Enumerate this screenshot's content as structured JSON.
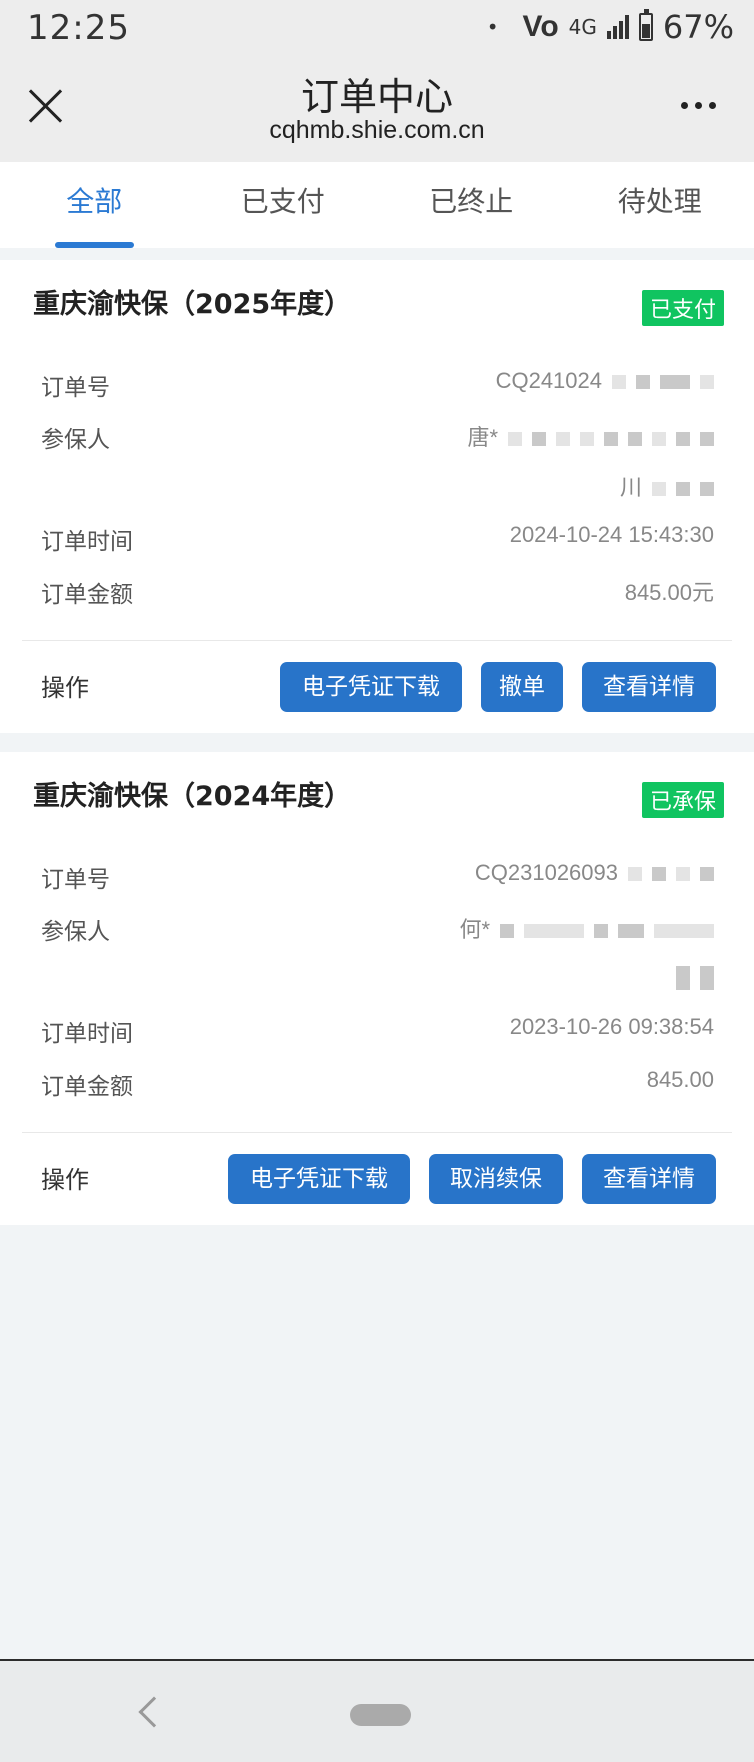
{
  "status": {
    "time": "12:25",
    "dot": "•",
    "volte": "Vo",
    "network": "4G",
    "battery": "67%"
  },
  "header": {
    "title": "订单中心",
    "url": "cqhmb.shie.com.cn"
  },
  "tabs": [
    {
      "label": "全部",
      "active": true
    },
    {
      "label": "已支付",
      "active": false
    },
    {
      "label": "已终止",
      "active": false
    },
    {
      "label": "待处理",
      "active": false
    }
  ],
  "orders": [
    {
      "title": "重庆渝快保（2025年度）",
      "status": "已支付",
      "order_no_label": "订单号",
      "order_no": "CQ241024",
      "insured_label": "参保人",
      "insured": "唐*",
      "insured_extra": "川",
      "time_label": "订单时间",
      "time": "2024-10-24 15:43:30",
      "amount_label": "订单金额",
      "amount": "845.00元",
      "action_label": "操作",
      "buttons": [
        "电子凭证下载",
        "撤单",
        "查看详情"
      ]
    },
    {
      "title": "重庆渝快保（2024年度）",
      "status": "已承保",
      "order_no_label": "订单号",
      "order_no": "CQ231026093",
      "insured_label": "参保人",
      "insured": "何*",
      "insured_extra": "",
      "time_label": "订单时间",
      "time": "2023-10-26 09:38:54",
      "amount_label": "订单金额",
      "amount": "845.00",
      "action_label": "操作",
      "buttons": [
        "电子凭证下载",
        "取消续保",
        "查看详情"
      ]
    }
  ],
  "colors": {
    "accent": "#2b7ad3",
    "button": "#2874c9",
    "badge": "#10c460",
    "background": "#f1f4f6"
  },
  "icons": [
    "close-icon",
    "more-icon",
    "battery-icon",
    "signal-icon",
    "back-icon",
    "home-pill"
  ]
}
